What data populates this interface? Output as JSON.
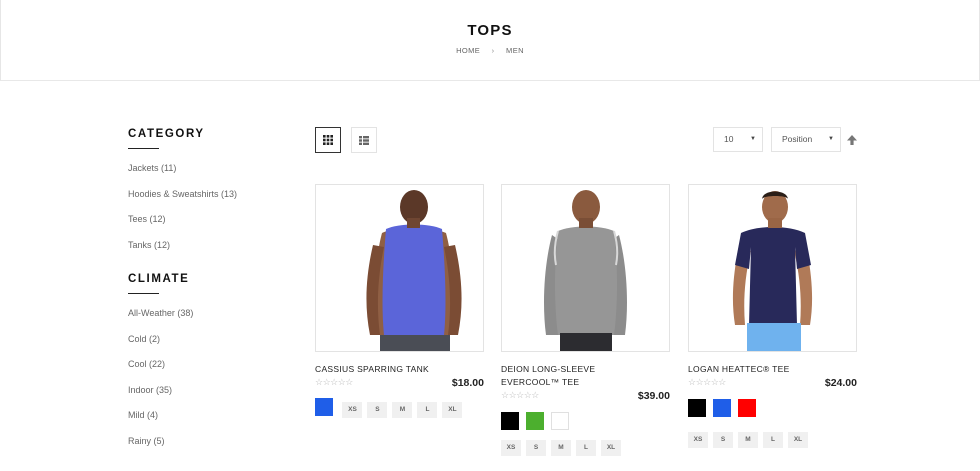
{
  "page": {
    "title": "TOPS",
    "breadcrumb": [
      "HOME",
      "MEN"
    ]
  },
  "sidebar": {
    "category_title": "CATEGORY",
    "categories": [
      "Jackets (11)",
      "Hoodies & Sweatshirts (13)",
      "Tees (12)",
      "Tanks (12)"
    ],
    "climate_title": "CLIMATE",
    "climates": [
      "All-Weather (38)",
      "Cold (2)",
      "Cool (22)",
      "Indoor (35)",
      "Mild (4)",
      "Rainy (5)"
    ]
  },
  "toolbar": {
    "grid_icon": "grid-view-icon",
    "list_icon": "list-view-icon",
    "limiter_value": "10",
    "sorter_value": "Position",
    "sort_direction_icon": "arrow-up-icon"
  },
  "products": [
    {
      "name": "CASSIUS SPARRING TANK",
      "price": "$18.00",
      "rating_display": "☆☆☆☆☆",
      "colors": [
        "#1f5ee8"
      ],
      "sizes": [
        "XS",
        "S",
        "M",
        "L",
        "XL"
      ]
    },
    {
      "name": "DEION LONG-SLEEVE EVERCOOL™ TEE",
      "price": "$39.00",
      "rating_display": "☆☆☆☆☆",
      "colors": [
        "#000000",
        "#4caf2e",
        "#ffffff"
      ],
      "sizes": [
        "XS",
        "S",
        "M",
        "L",
        "XL"
      ]
    },
    {
      "name": "LOGAN HEATTEC® TEE",
      "price": "$24.00",
      "rating_display": "☆☆☆☆☆",
      "colors": [
        "#000000",
        "#1f5ee8",
        "#ff0000"
      ],
      "sizes": [
        "XS",
        "S",
        "M",
        "L",
        "XL"
      ]
    }
  ]
}
